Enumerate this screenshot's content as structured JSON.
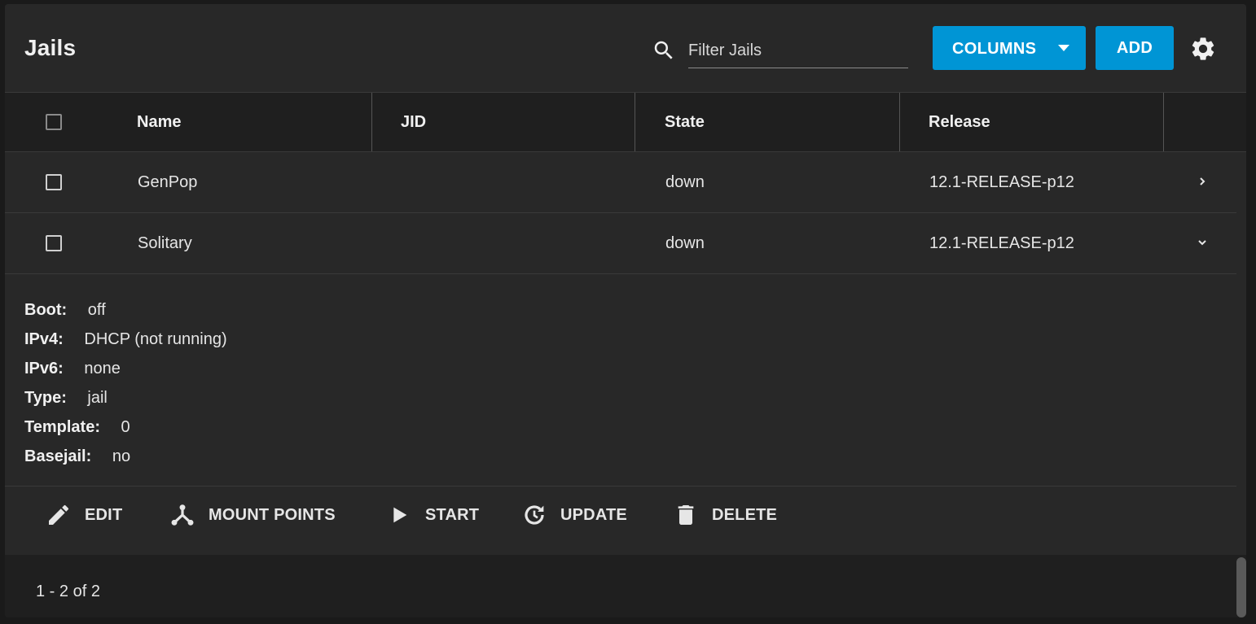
{
  "header": {
    "title": "Jails",
    "search_placeholder": "Filter Jails",
    "columns_label": "COLUMNS",
    "add_label": "ADD"
  },
  "table": {
    "columns": [
      "Name",
      "JID",
      "State",
      "Release"
    ],
    "rows": [
      {
        "name": "GenPop",
        "jid": "",
        "state": "down",
        "release": "12.1-RELEASE-p12",
        "expanded": false
      },
      {
        "name": "Solitary",
        "jid": "",
        "state": "down",
        "release": "12.1-RELEASE-p12",
        "expanded": true
      }
    ]
  },
  "details": [
    {
      "key": "Boot:",
      "value": "off"
    },
    {
      "key": "IPv4:",
      "value": "DHCP (not running)"
    },
    {
      "key": "IPv6:",
      "value": "none"
    },
    {
      "key": "Type:",
      "value": "jail"
    },
    {
      "key": "Template:",
      "value": "0"
    },
    {
      "key": "Basejail:",
      "value": "no"
    }
  ],
  "actions": [
    {
      "label": "EDIT",
      "icon": "pencil-icon"
    },
    {
      "label": "MOUNT POINTS",
      "icon": "mount-points-icon"
    },
    {
      "label": "START",
      "icon": "play-icon"
    },
    {
      "label": "UPDATE",
      "icon": "update-icon"
    },
    {
      "label": "DELETE",
      "icon": "trash-icon"
    }
  ],
  "footer": {
    "pagination": "1 - 2 of 2"
  },
  "colors": {
    "accent": "#0095d5",
    "card": "#282828",
    "header_row": "#1f1f1f"
  }
}
